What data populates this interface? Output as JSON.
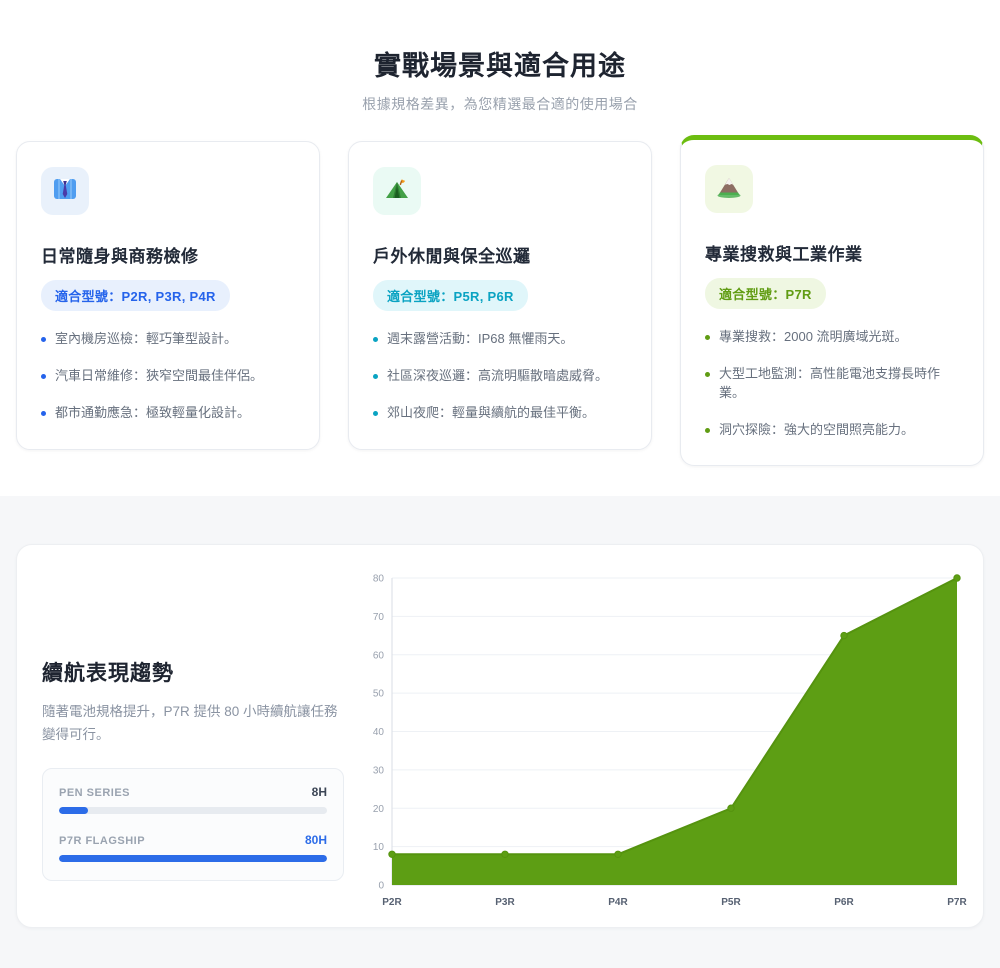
{
  "header": {
    "title": "實戰場景與適合用途",
    "subtitle": "根據規格差異，為您精選最合適的使用場合"
  },
  "cards": [
    {
      "icon": "necktie-icon",
      "title": "日常隨身與商務檢修",
      "badge": "適合型號：P2R, P3R, P4R",
      "accent_color": "#2563eb",
      "badge_bg": "#e8f0fd",
      "icon_bg": "#e9f1fb",
      "bullets": [
        "室內機房巡檢：輕巧筆型設計。",
        "汽車日常維修：狹窄空間最佳伴侶。",
        "都市通勤應急：極致輕量化設計。"
      ]
    },
    {
      "icon": "camping-tent-icon",
      "title": "戶外休閒與保全巡邏",
      "badge": "適合型號：P5R, P6R",
      "accent_color": "#0aa3c2",
      "badge_bg": "#e0f6fa",
      "icon_bg": "#eafaf4",
      "bullets": [
        "週末露營活動：IP68 無懼雨天。",
        "社區深夜巡邏：高流明驅散暗處威脅。",
        "郊山夜爬：輕量與續航的最佳平衡。"
      ]
    },
    {
      "icon": "mountain-icon",
      "title": "專業搜救與工業作業",
      "badge": "適合型號：P7R",
      "accent_color": "#609c13",
      "badge_bg": "#eff7e2",
      "icon_bg": "#f1f8e3",
      "top_border_color": "#6cbd10",
      "bullets": [
        "專業搜救：2000 流明廣域光斑。",
        "大型工地監測：高性能電池支撐長時作業。",
        "洞穴探險：強大的空間照亮能力。"
      ]
    }
  ],
  "battery_section": {
    "title": "續航表現趨勢",
    "description": "隨著電池規格提升，P7R 提供 80 小時續航讓任務變得可行。",
    "bars": [
      {
        "label": "PEN SERIES",
        "value": "8H",
        "percent": 11,
        "value_color": "#3c4656"
      },
      {
        "label": "P7R FLAGSHIP",
        "value": "80H",
        "percent": 100,
        "value_color": "#2c6ce8"
      }
    ]
  },
  "chart_data": {
    "type": "area",
    "categories": [
      "P2R",
      "P3R",
      "P4R",
      "P5R",
      "P6R",
      "P7R"
    ],
    "values": [
      8,
      8,
      8,
      20,
      65,
      80
    ],
    "title": "",
    "xlabel": "",
    "ylabel": "",
    "ylim": [
      0,
      80
    ],
    "ytick_step": 10,
    "grid": true,
    "legend": "none",
    "fill_color": "#5d9e14",
    "line_color": "#55930f",
    "axis_label_color": "#99a1ae",
    "x_label_color": "#576172",
    "grid_color": "#eef1f5",
    "axis_line_color": "#d9dee5"
  }
}
